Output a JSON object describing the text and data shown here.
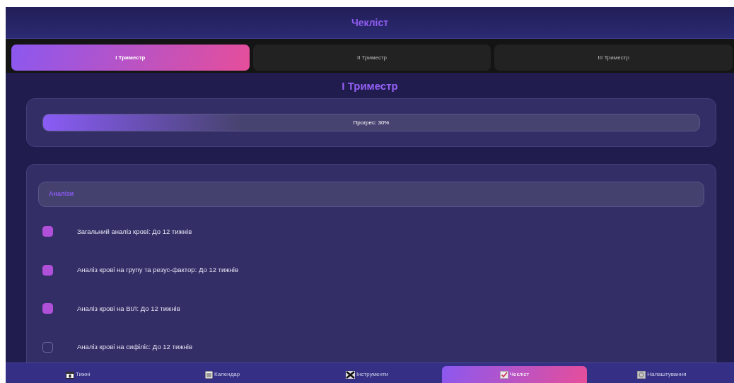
{
  "header": {
    "title": "Чекліст"
  },
  "tabs": [
    {
      "label": "I Триместр",
      "selected": true
    },
    {
      "label": "II Триместр",
      "selected": false
    },
    {
      "label": "III Триместр",
      "selected": false
    }
  ],
  "section_title": "I Триместр",
  "progress": {
    "label": "Прогрес: 30%",
    "level": 0.3
  },
  "group": {
    "title": "Аналізи",
    "items": [
      {
        "label": "Загальний аналіз крові: До 12 тижнів",
        "checked": true
      },
      {
        "label": "Аналіз крові на групу та резус-фактор: До 12 тижнів",
        "checked": true
      },
      {
        "label": "Аналіз крові на ВІЛ: До 12 тижнів",
        "checked": true
      },
      {
        "label": "Аналіз крові на сифіліс: До 12 тижнів",
        "checked": false
      }
    ]
  },
  "bottom_nav": [
    {
      "kind": "weeks",
      "label": "Тижні",
      "selected": false
    },
    {
      "kind": "calendar",
      "label": "Календар",
      "selected": false
    },
    {
      "kind": "tools",
      "label": "Інструменти",
      "selected": false
    },
    {
      "kind": "checklist",
      "label": "Чекліст",
      "selected": true
    },
    {
      "kind": "settings",
      "label": "Налаштування",
      "selected": false
    }
  ]
}
